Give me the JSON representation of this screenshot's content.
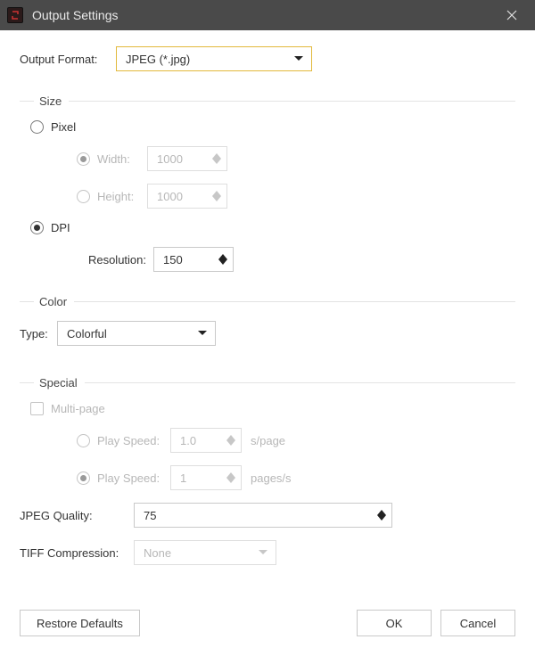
{
  "title": "Output Settings",
  "outputFormat": {
    "label": "Output Format:",
    "value": "JPEG (*.jpg)"
  },
  "groups": {
    "size": {
      "title": "Size",
      "pixel": {
        "label": "Pixel",
        "width": {
          "label": "Width:",
          "value": "1000"
        },
        "height": {
          "label": "Height:",
          "value": "1000"
        }
      },
      "dpi": {
        "label": "DPI",
        "resolution": {
          "label": "Resolution:",
          "value": "150"
        }
      }
    },
    "color": {
      "title": "Color",
      "type": {
        "label": "Type:",
        "value": "Colorful"
      }
    },
    "special": {
      "title": "Special",
      "multipage": {
        "label": "Multi-page"
      },
      "speedA": {
        "label": "Play Speed:",
        "value": "1.0",
        "unit": "s/page"
      },
      "speedB": {
        "label": "Play Speed:",
        "value": "1",
        "unit": "pages/s"
      },
      "jpegQuality": {
        "label": "JPEG Quality:",
        "value": "75"
      },
      "tiff": {
        "label": "TIFF Compression:",
        "value": "None"
      }
    }
  },
  "buttons": {
    "restore": "Restore Defaults",
    "ok": "OK",
    "cancel": "Cancel"
  }
}
